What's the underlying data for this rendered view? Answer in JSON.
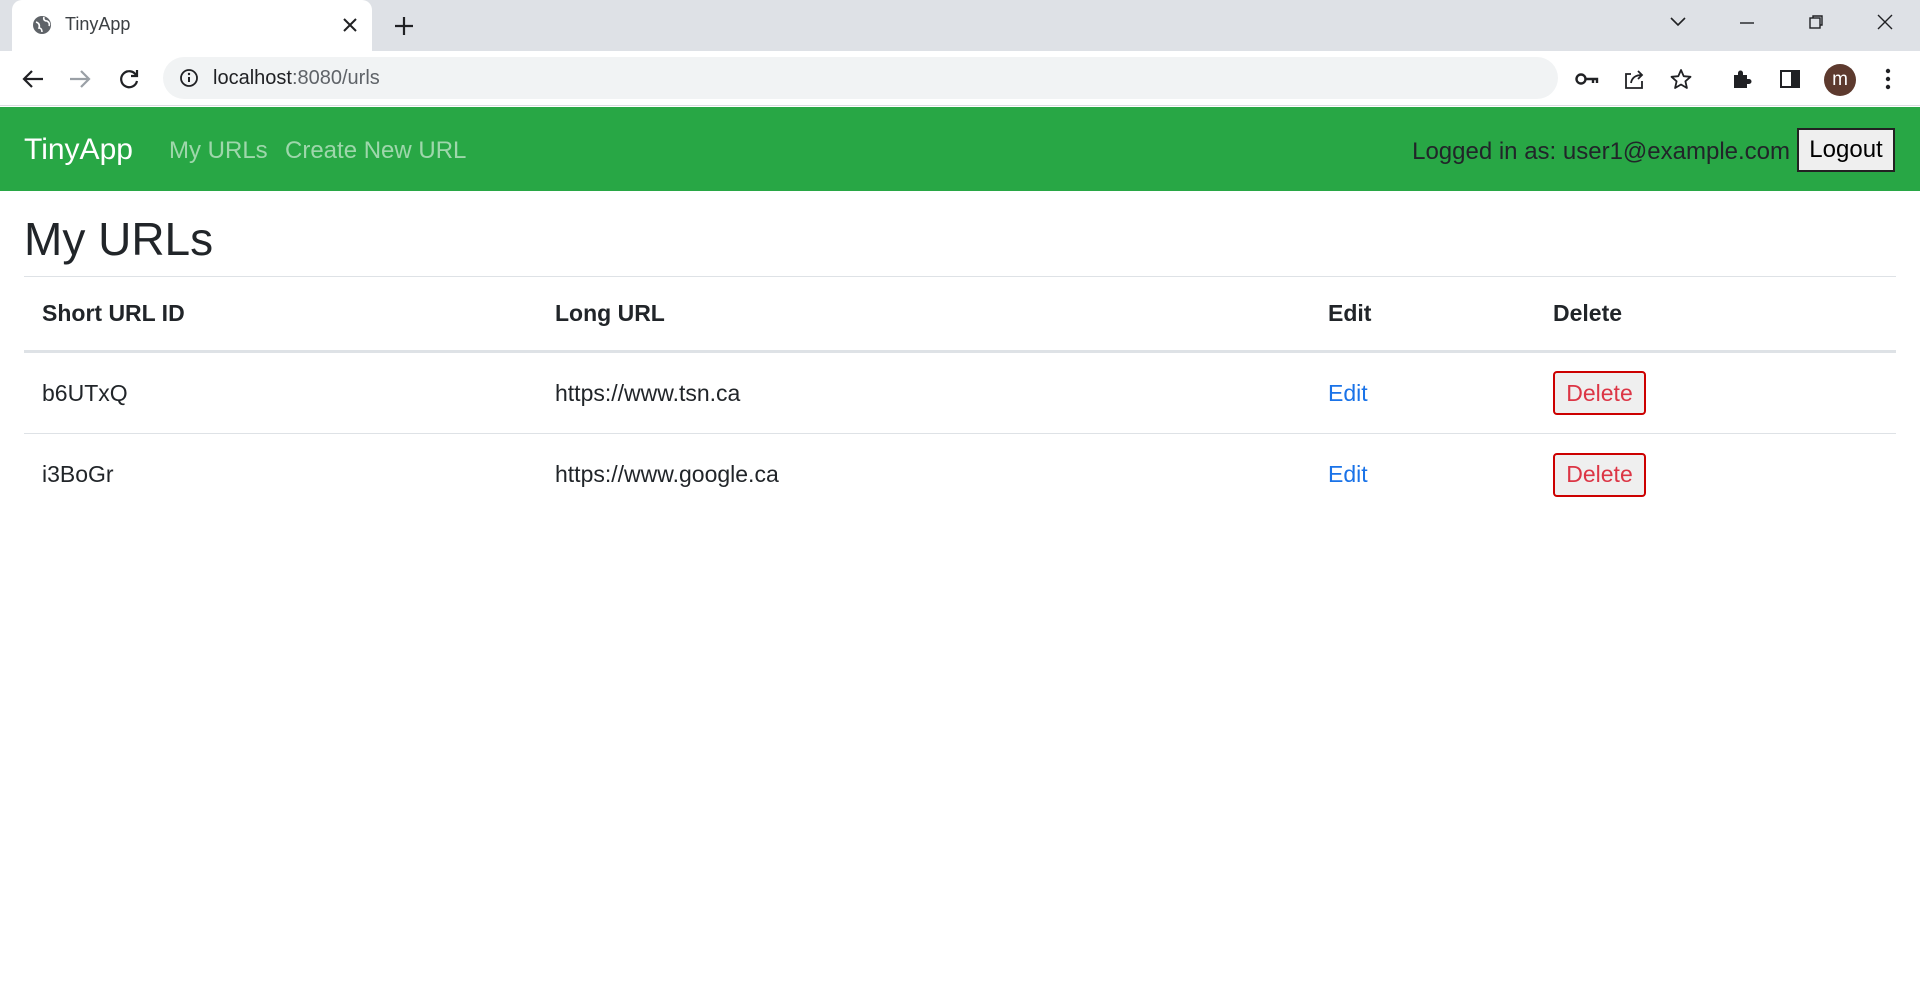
{
  "browser": {
    "tab_title": "TinyApp",
    "url_host": "localhost",
    "url_path": ":8080/urls",
    "avatar_letter": "m",
    "icons": [
      "globe-icon",
      "close-icon",
      "plus-icon",
      "chevron-down-icon",
      "minimize-icon",
      "restore-icon",
      "window-close-icon",
      "back-icon",
      "forward-icon",
      "reload-icon",
      "info-icon",
      "key-icon",
      "share-icon",
      "star-icon",
      "puzzle-icon",
      "sidepanel-icon",
      "kebab-menu-icon"
    ]
  },
  "navbar": {
    "brand": "TinyApp",
    "links": [
      "My URLs",
      "Create New URL"
    ],
    "logged_in_text": "Logged in as: user1@example.com",
    "logout_label": "Logout",
    "background_color": "#28a745"
  },
  "main": {
    "title": "My URLs",
    "table": {
      "headers": [
        "Short URL ID",
        "Long URL",
        "Edit",
        "Delete"
      ],
      "rows": [
        {
          "short_id": "b6UTxQ",
          "long_url": "https://www.tsn.ca",
          "edit_label": "Edit",
          "delete_label": "Delete"
        },
        {
          "short_id": "i3BoGr",
          "long_url": "https://www.google.ca",
          "edit_label": "Edit",
          "delete_label": "Delete"
        }
      ]
    }
  }
}
